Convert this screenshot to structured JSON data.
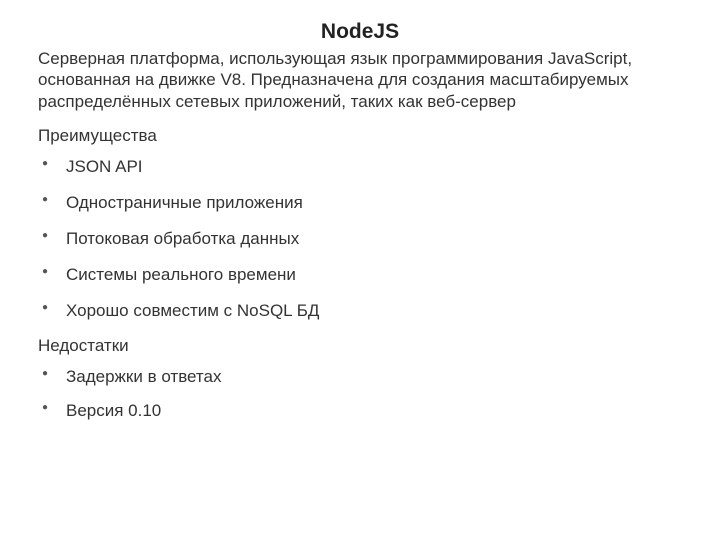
{
  "title": "NodeJS",
  "description": "Серверная платформа, использующая язык программирования JavaScript, основанная на движке V8. Предназначена для создания масштабируемых распределённых сетевых приложений, таких как веб-сервер",
  "advantages": {
    "heading": "Преимущества",
    "items": [
      "JSON API",
      "Одностраничные приложения",
      "Потоковая обработка данных",
      "Системы реального времени",
      "Хорошо совместим с NoSQL БД"
    ]
  },
  "disadvantages": {
    "heading": "Недостатки",
    "items": [
      "Задержки в ответах",
      "Версия 0.10"
    ]
  }
}
